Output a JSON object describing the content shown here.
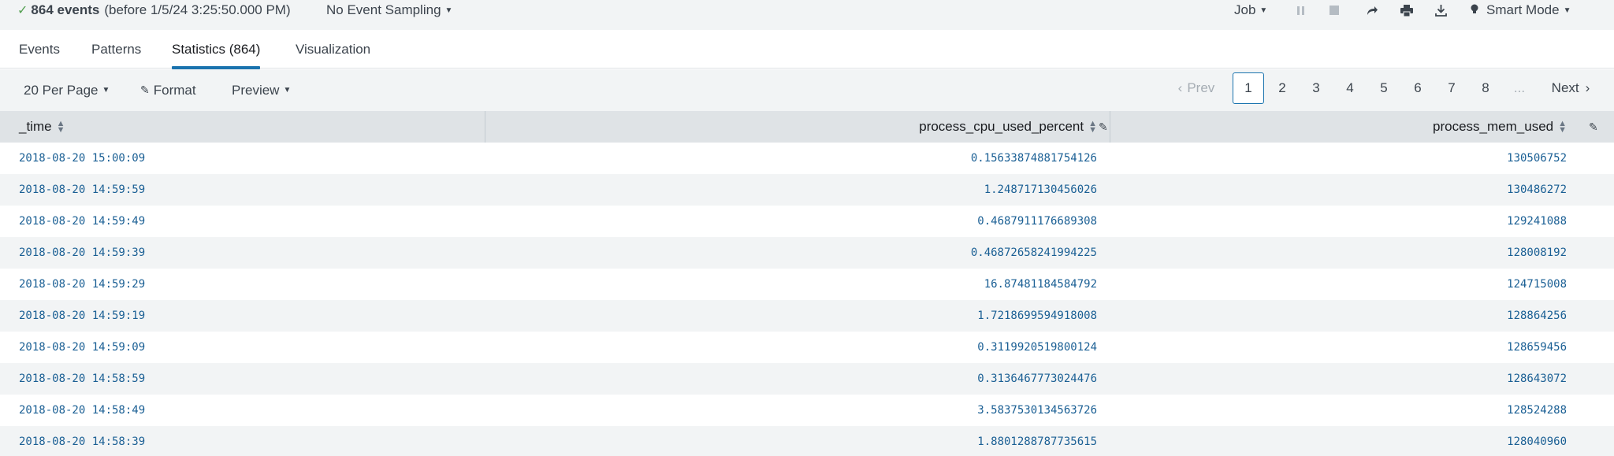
{
  "status": {
    "check_icon": "checkmark-icon",
    "events_count": "864 events",
    "events_suffix": "(before 1/5/24 3:25:50.000 PM)",
    "sampling_label": "No Event Sampling",
    "job_label": "Job",
    "smart_mode_label": "Smart Mode",
    "icons": [
      "pause-icon",
      "stop-icon",
      "share-icon",
      "print-icon",
      "export-icon",
      "bulb-icon"
    ]
  },
  "tabs": [
    {
      "label": "Events"
    },
    {
      "label": "Patterns"
    },
    {
      "label": "Statistics (864)",
      "active": true
    },
    {
      "label": "Visualization"
    }
  ],
  "toolbar": {
    "per_page_label": "20 Per Page",
    "format_label": "Format",
    "preview_label": "Preview"
  },
  "pagination": {
    "prev_label": "Prev",
    "pages": [
      "1",
      "2",
      "3",
      "4",
      "5",
      "6",
      "7",
      "8"
    ],
    "current": "1",
    "ellipsis": "...",
    "next_label": "Next"
  },
  "table": {
    "columns": [
      "_time",
      "process_cpu_used_percent",
      "process_mem_used"
    ],
    "rows": [
      [
        "2018-08-20 15:00:09",
        "0.15633874881754126",
        "130506752"
      ],
      [
        "2018-08-20 14:59:59",
        "1.248717130456026",
        "130486272"
      ],
      [
        "2018-08-20 14:59:49",
        "0.4687911176689308",
        "129241088"
      ],
      [
        "2018-08-20 14:59:39",
        "0.46872658241994225",
        "128008192"
      ],
      [
        "2018-08-20 14:59:29",
        "16.87481184584792",
        "124715008"
      ],
      [
        "2018-08-20 14:59:19",
        "1.7218699594918008",
        "128864256"
      ],
      [
        "2018-08-20 14:59:09",
        "0.3119920519800124",
        "128659456"
      ],
      [
        "2018-08-20 14:58:59",
        "0.3136467773024476",
        "128643072"
      ],
      [
        "2018-08-20 14:58:49",
        "3.5837530134563726",
        "128524288"
      ],
      [
        "2018-08-20 14:58:39",
        "1.8801288787735615",
        "128040960"
      ]
    ]
  },
  "colors": {
    "accent": "#1a73ae",
    "link_text": "#1a5f94",
    "success": "#53a051",
    "header_bg": "#dfe3e6",
    "band_bg": "#f2f4f5"
  }
}
